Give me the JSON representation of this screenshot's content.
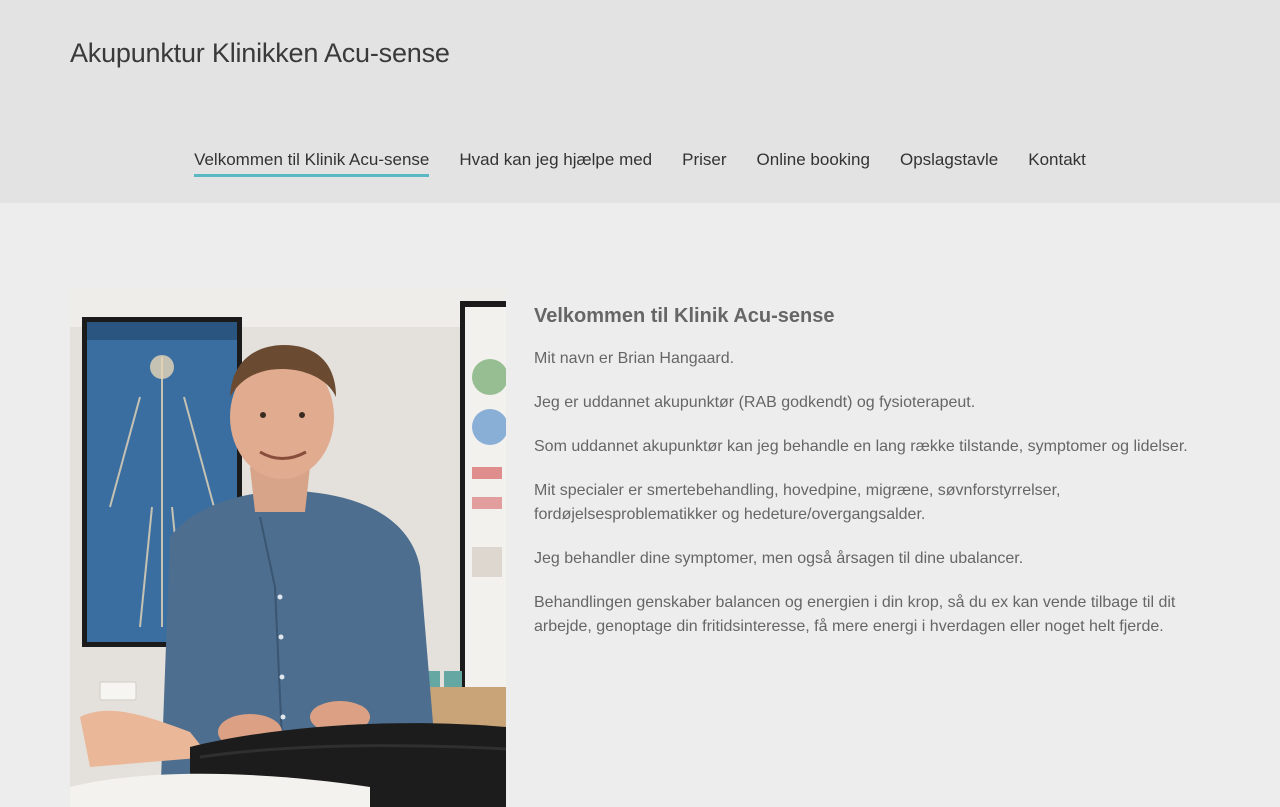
{
  "header": {
    "site_title": "Akupunktur Klinikken Acu-sense"
  },
  "nav": {
    "items": [
      {
        "label": "Velkommen til Klinik Acu-sense",
        "active": true
      },
      {
        "label": "Hvad kan jeg hjælpe med",
        "active": false
      },
      {
        "label": "Priser",
        "active": false
      },
      {
        "label": "Online booking",
        "active": false
      },
      {
        "label": "Opslagstavle",
        "active": false
      },
      {
        "label": "Kontakt",
        "active": false
      }
    ],
    "active_color": "#5ab8c4"
  },
  "main": {
    "heading": "Velkommen til Klinik Acu-sense",
    "paragraphs": [
      "Mit navn er Brian Hangaard.",
      "Jeg er uddannet akupunktør (RAB godkendt) og fysioterapeut.",
      "Som uddannet akupunktør kan jeg behandle en lang række tilstande, symptomer og lidelser.",
      "Mit specialer er smertebehandling, hovedpine, migræne, søvnforstyrrelser, fordøjelsesproblematikker og hedeture/overgangsalder.",
      "Jeg behandler dine symptomer, men også årsagen til dine ubalancer.",
      "Behandlingen genskaber balancen og energien i din krop, så du ex kan vende tilbage til dit arbejde, genoptage din fritidsinteresse, få mere energi i hverdagen eller noget helt fjerde."
    ],
    "photo_description_icon": "therapist-photo"
  }
}
